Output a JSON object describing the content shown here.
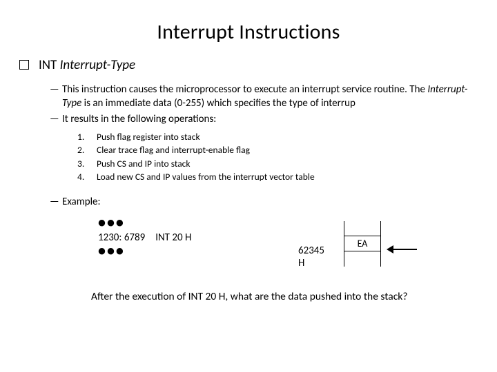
{
  "title": "Interrupt Instructions",
  "heading_mnemonic": "INT ",
  "heading_operand": "Interrupt-Type",
  "desc1_a": "This instruction causes the microprocessor to execute an interrupt service routine. The ",
  "desc1_it": "Interrupt-Type",
  "desc1_b": " is an immediate data (0-255) which specifies the type of interrup",
  "desc2": "It results in the following operations:",
  "ops": [
    {
      "n": "1.",
      "t": "Push flag register into stack"
    },
    {
      "n": "2.",
      "t": "Clear trace flag and interrupt-enable flag"
    },
    {
      "n": "3.",
      "t": "Push CS and IP into stack"
    },
    {
      "n": "4.",
      "t": "Load new CS and IP values from the interrupt vector table"
    }
  ],
  "example_label": "Example:",
  "code_line": "1230: 6789 INT 20 H",
  "stack_addr": "62345 H",
  "stack_cell": "EA",
  "question": "After the execution of INT 20 H, what are the data pushed into the stack?",
  "dash": "—",
  "dots": "•••"
}
